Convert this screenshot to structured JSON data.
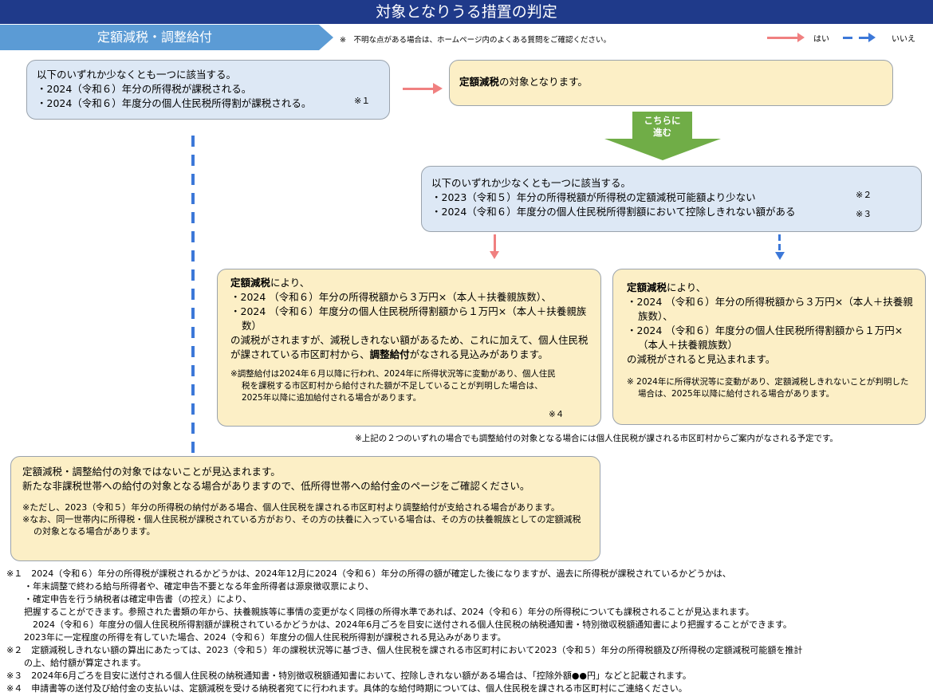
{
  "header": {
    "title": "対象となりうる措置の判定",
    "section_tab": "定額減税・調整給付",
    "note": "※　不明な点がある場合は、ホームページ内のよくある質問をご確認ください。",
    "legend_yes": "はい",
    "legend_no": "いいえ"
  },
  "box1": {
    "line1": "以下のいずれか少なくとも一つに該当する。",
    "line2": "・2024（令和６）年分の所得税が課税される。",
    "line3": "・2024（令和６）年度分の個人住民税所得割が課税される。",
    "mark": "※１"
  },
  "box2": {
    "bold": "定額減税",
    "rest": "の対象となります。"
  },
  "proceed": {
    "line1": "こちらに",
    "line2": "進む"
  },
  "box3": {
    "line1": "以下のいずれか少なくとも一つに該当する。",
    "line2": "・2023（令和５）年分の所得税額が所得税の定額減税可能額より少ない",
    "line3": "・2024（令和６）年度分の個人住民税所得割額において控除しきれない額がある",
    "mark2": "※２",
    "mark3": "※３"
  },
  "box4": {
    "bold1": "定額減税",
    "intro_rest": "により、",
    "item1": "・2024 （令和６）年分の所得税額から３万円×（本人＋扶養親族数）、",
    "item2": "・2024 （令和６）年度分の個人住民税所得割額から１万円×（本人＋扶養親族数）",
    "body1": "の減税がされますが、減税しきれない額があるため、これに加えて、個人住民税が課されている市区町村から、",
    "bold2": "調整給付",
    "body2": "がなされる見込みがあります。",
    "note": "※調整給付は2024年６月以降に行われ、2024年に所得状況等に変動があり、個人住民税を課税する市区町村から給付された額が不足していることが判明した場合は、2025年以降に追加給付される場合があります。",
    "mark4": "※４"
  },
  "box5": {
    "bold1": "定額減税",
    "intro_rest": "により、",
    "item1": "・2024 （令和６）年分の所得税額から３万円×（本人＋扶養親族数）、",
    "item2": "・2024 （令和６）年度分の個人住民税所得割額から１万円×（本人＋扶養親族数）",
    "body": "の減税がされると見込まれます。",
    "note": "※ 2024年に所得状況等に変動があり、定額減税しきれないことが判明した場合は、2025年以降に給付される場合があります。"
  },
  "mid_note": "※上記の２つのいずれの場合でも調整給付の対象となる場合には個人住民税が課される市区町村からご案内がなされる予定です。",
  "box6": {
    "line1": "定額減税・調整給付の対象ではないことが見込まれます。",
    "line2": "新たな非課税世帯への給付の対象となる場合がありますので、低所得世帯への給付金のページをご確認ください。",
    "note1": "※ただし、2023（令和５）年分の所得税の納付がある場合、個人住民税を課される市区町村より調整給付が支給される場合があります。",
    "note2": "※なお、同一世帯内に所得税・個人住民税が課税されている方がおり、その方の扶養に入っている場合は、その方の扶養親族としての定額減税の対象となる場合があります。"
  },
  "footnotes": [
    "※１　2024（令和６）年分の所得税が課税されるかどうかは、2024年12月に2024（令和６）年分の所得の額が確定した後になりますが、過去に所得税が課税されているかどうかは、",
    "　　・年末調整で終わる給与所得者や、確定申告不要となる年金所得者は源泉徴収票により、",
    "　　・確定申告を行う納税者は確定申告書（の控え）により、",
    "　　把握することができます。参照された書類の年から、扶養親族等に事情の変更がなく同様の所得水準であれば、2024（令和６）年分の所得税についても課税されることが見込まれます。",
    "　　　2024（令和６）年度分の個人住民税所得割額が課税されているかどうかは、2024年6月ごろを目安に送付される個人住民税の納税通知書・特別徴収税額通知書により把握することができます。",
    "　　2023年に一定程度の所得を有していた場合、2024（令和６）年度分の個人住民税所得割が課税される見込みがあります。",
    "※２　定額減税しきれない額の算出にあたっては、2023（令和５）年の課税状況等に基づき、個人住民税を課される市区町村において2023（令和５）年分の所得税額及び所得税の定額減税可能額を推計",
    "　　の上、給付額が算定されます。",
    "※３　2024年6月ごろを目安に送付される個人住民税の納税通知書・特別徴収税額通知書において、控除しきれない額がある場合は、「控除外額●●円」などと記載されます。",
    "※４　申請書等の送付及び給付金の支払いは、定額減税を受ける納税者宛てに行われます。具体的な給付時期については、個人住民税を課される市区町村にご連絡ください。"
  ]
}
